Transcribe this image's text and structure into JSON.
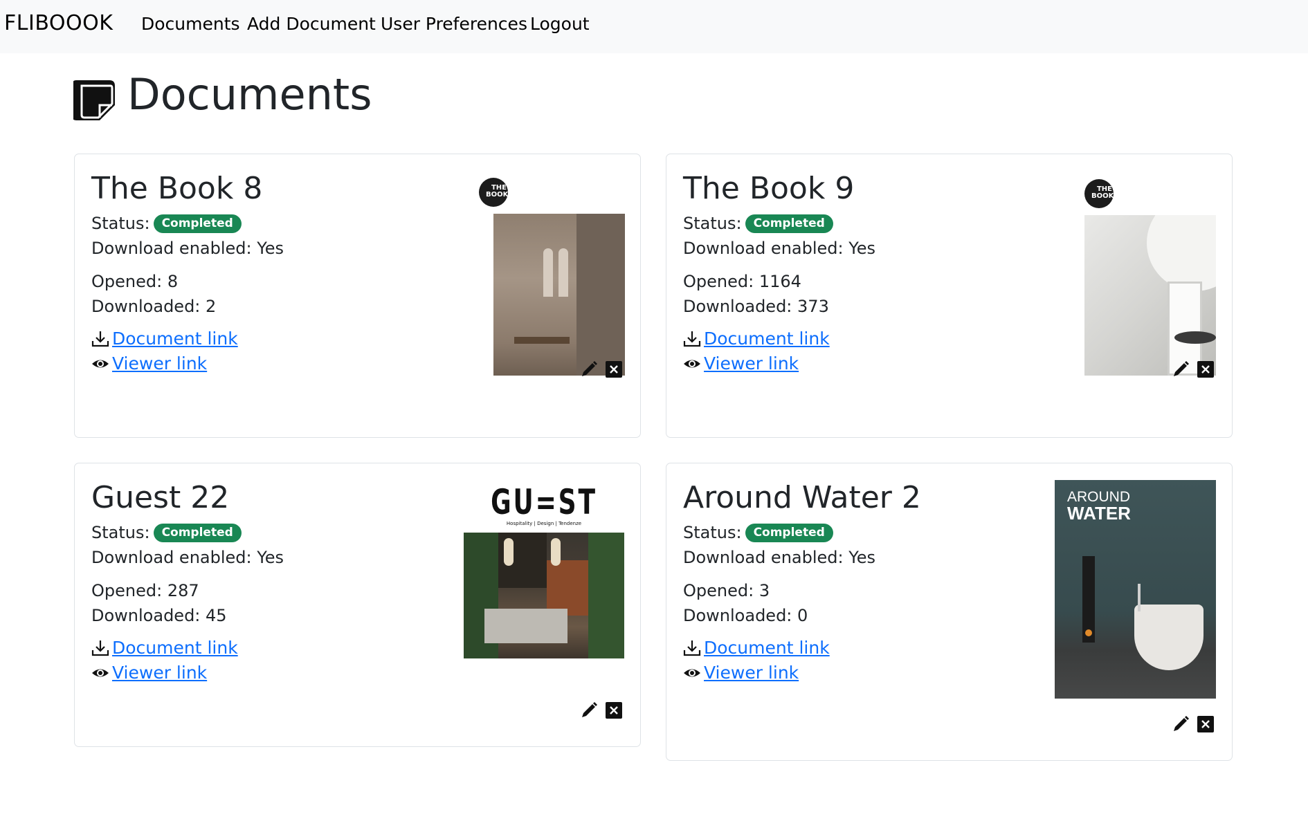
{
  "navbar": {
    "brand": "FLIBOOOK",
    "items": [
      "Documents",
      "Add Document",
      "User Preferences",
      "Logout"
    ]
  },
  "page": {
    "title": "Documents"
  },
  "labels": {
    "status": "Status:",
    "download_enabled": "Download enabled:",
    "opened": "Opened:",
    "downloaded": "Downloaded:",
    "document_link": "Document link",
    "viewer_link": "Viewer link"
  },
  "documents": [
    {
      "title": "The Book 8",
      "status": "Completed",
      "download_enabled": "Yes",
      "opened": "8",
      "downloaded": "2",
      "cover_brand": "THE BOOK"
    },
    {
      "title": "The Book 9",
      "status": "Completed",
      "download_enabled": "Yes",
      "opened": "1164",
      "downloaded": "373",
      "cover_brand": "THE BOOK"
    },
    {
      "title": "Guest 22",
      "status": "Completed",
      "download_enabled": "Yes",
      "opened": "287",
      "downloaded": "45",
      "cover_brand": "GU=ST",
      "cover_tagline": "Hospitality | Design | Tendenze"
    },
    {
      "title": "Around Water 2",
      "status": "Completed",
      "download_enabled": "Yes",
      "opened": "3",
      "downloaded": "0",
      "cover_brand_line1": "AROUND",
      "cover_brand_line2": "WATER"
    }
  ],
  "colors": {
    "badge": "#198754",
    "link": "#0d6efd",
    "navbar_bg": "#f8f9fa"
  }
}
